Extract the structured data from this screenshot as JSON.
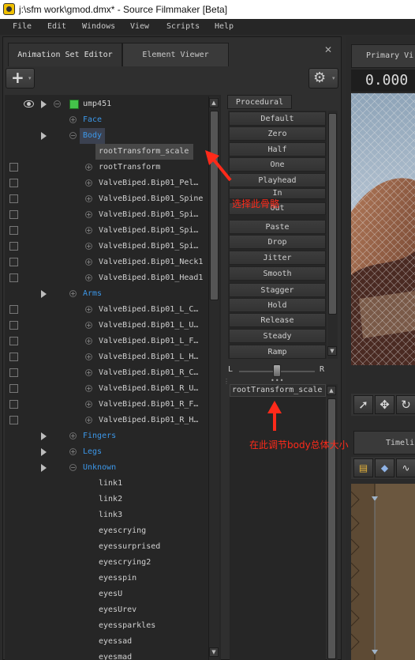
{
  "window": {
    "title": "j:\\sfm work\\gmod.dmx* - Source Filmmaker [Beta]"
  },
  "menu": [
    "File",
    "Edit",
    "Windows",
    "View",
    "Scripts",
    "Help"
  ],
  "left_panel": {
    "tabs": [
      "Animation Set Editor",
      "Element Viewer"
    ],
    "add_button": "+",
    "gear_icon": "gear-icon"
  },
  "tree": {
    "root": "ump451",
    "items": [
      {
        "label": "Face",
        "color": "blue"
      },
      {
        "label": "Body",
        "color": "blue"
      },
      {
        "label": "rootTransform_scale"
      },
      {
        "label": "rootTransform"
      },
      {
        "label": "ValveBiped.Bip01_Pel…"
      },
      {
        "label": "ValveBiped.Bip01_Spine"
      },
      {
        "label": "ValveBiped.Bip01_Spi…"
      },
      {
        "label": "ValveBiped.Bip01_Spi…"
      },
      {
        "label": "ValveBiped.Bip01_Spi…"
      },
      {
        "label": "ValveBiped.Bip01_Neck1"
      },
      {
        "label": "ValveBiped.Bip01_Head1"
      },
      {
        "label": "Arms",
        "color": "blue"
      },
      {
        "label": "ValveBiped.Bip01_L_C…"
      },
      {
        "label": "ValveBiped.Bip01_L_U…"
      },
      {
        "label": "ValveBiped.Bip01_L_F…"
      },
      {
        "label": "ValveBiped.Bip01_L_H…"
      },
      {
        "label": "ValveBiped.Bip01_R_C…"
      },
      {
        "label": "ValveBiped.Bip01_R_U…"
      },
      {
        "label": "ValveBiped.Bip01_R_F…"
      },
      {
        "label": "ValveBiped.Bip01_R_H…"
      },
      {
        "label": "Fingers",
        "color": "blue"
      },
      {
        "label": "Legs",
        "color": "blue"
      },
      {
        "label": "Unknown",
        "color": "blue"
      },
      {
        "label": "link1"
      },
      {
        "label": "link2"
      },
      {
        "label": "link3"
      },
      {
        "label": "eyescrying"
      },
      {
        "label": "eyessurprised"
      },
      {
        "label": "eyescrying2"
      },
      {
        "label": "eyesspin"
      },
      {
        "label": "eyesU"
      },
      {
        "label": "eyesUrev"
      },
      {
        "label": "eyessparkles"
      },
      {
        "label": "eyessad"
      },
      {
        "label": "eyesmad"
      }
    ]
  },
  "procedural": {
    "tab": "Procedural",
    "buttons": [
      "Default",
      "Zero",
      "Half",
      "One",
      "Playhead",
      "In",
      "Out",
      "Paste",
      "Drop",
      "Jitter",
      "Smooth",
      "Stagger",
      "Hold",
      "Release",
      "Steady",
      "Ramp"
    ],
    "balance_left": "L",
    "balance_right": "R",
    "slider_name": "rootTransform_scale"
  },
  "right_panel": {
    "viewer_tab": "Primary Vi",
    "time": "0.000",
    "timeline_tab": "Timeli"
  },
  "annotations": {
    "select_bone": "选择此骨骼",
    "adjust_size": "在此调节body总体大小"
  },
  "colors": {
    "accent_blue": "#3c97e8",
    "annotation_red": "#ff2a1a"
  }
}
